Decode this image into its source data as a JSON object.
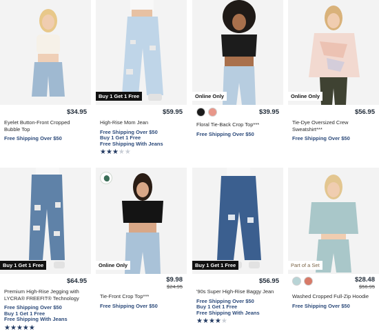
{
  "colors": {
    "accent": "#2c4a7a",
    "star": "#243b63",
    "badge_dark": "#111111"
  },
  "products": [
    {
      "badge": "",
      "price": "$34.95",
      "name": "Eyelet Button-Front Cropped Bubble Top",
      "promos": [
        "Free Shipping Over $50"
      ],
      "swatches": [],
      "rating": 0
    },
    {
      "badge": "Buy 1 Get 1 Free",
      "price": "$59.95",
      "name": "High-Rise Mom Jean",
      "promos": [
        "Free Shipping Over $50",
        "Buy 1 Get 1 Free",
        "Free Shipping With Jeans"
      ],
      "swatches": [],
      "rating": 3
    },
    {
      "badge": "Online Only",
      "price": "$39.95",
      "name": "Floral Tie-Back Crop Top***",
      "promos": [
        "Free Shipping Over $50"
      ],
      "swatches": [
        "#1b1b1b",
        "#e8978a"
      ],
      "rating": 0
    },
    {
      "badge": "Online Only",
      "price": "$56.95",
      "name": "Tie-Dye Oversized Crew Sweatshirt***",
      "promos": [
        "Free Shipping Over $50"
      ],
      "swatches": [],
      "rating": 0
    },
    {
      "badge": "Buy 1 Get 1 Free",
      "price": "$64.95",
      "name": "Premium High-Rise Jegging with LYCRA® FREEFIT® Technology",
      "promos": [
        "Free Shipping Over $50",
        "Buy 1 Get 1 Free",
        "Free Shipping With Jeans"
      ],
      "swatches": [],
      "rating": 5
    },
    {
      "badge": "Online Only",
      "price": "$9.98",
      "was": "$24.95",
      "name": "Tie-Front Crop Top***",
      "promos": [
        "Free Shipping Over $50"
      ],
      "swatches": [],
      "rating": 0
    },
    {
      "badge": "Buy 1 Get 1 Free",
      "price": "$56.95",
      "name": "'90s Super High-Rise Baggy Jean",
      "promos": [
        "Free Shipping Over $50",
        "Buy 1 Get 1 Free",
        "Free Shipping With Jeans"
      ],
      "swatches": [],
      "rating": 4
    },
    {
      "badge": "Part of a Set",
      "price": "$28.48",
      "was": "$56.95",
      "name": "Washed Cropped Full-Zip Hoodie",
      "promos": [
        "Free Shipping Over $50"
      ],
      "swatches": [
        "#b8d4d6",
        "#d77a68"
      ],
      "rating": 0
    }
  ]
}
